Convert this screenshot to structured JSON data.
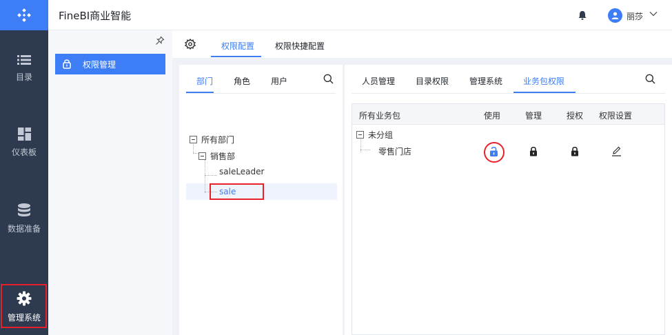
{
  "app": {
    "title": "FineBI商业智能",
    "user": "丽莎"
  },
  "leftnav": {
    "items": [
      {
        "label": "目录"
      },
      {
        "label": "仪表板"
      },
      {
        "label": "数据准备"
      },
      {
        "label": "管理系统"
      }
    ]
  },
  "subnav": {
    "item": "权限管理"
  },
  "main_tabs": [
    "权限配置",
    "权限快捷配置"
  ],
  "org_panel": {
    "tabs": [
      "部门",
      "角色",
      "用户"
    ],
    "tree": {
      "root": "所有部门",
      "dept": "销售部",
      "children": [
        "saleLeader",
        "sale"
      ]
    }
  },
  "perm_panel": {
    "tabs": [
      "人员管理",
      "目录权限",
      "管理系统",
      "业务包权限"
    ],
    "headers": [
      "所有业务包",
      "使用",
      "管理",
      "授权",
      "权限设置"
    ],
    "group": "未分组",
    "package": "零售门店"
  },
  "colors": {
    "accent": "#3d7df5",
    "nav_bg": "#2d3a4f",
    "highlight": "#e8202a"
  },
  "icons": [
    "logo-icon",
    "bell-icon",
    "user-icon",
    "chevron-down-icon",
    "list-icon",
    "dashboard-icon",
    "database-icon",
    "gear-icon",
    "pin-icon",
    "lock-icon",
    "search-icon",
    "unlock-icon",
    "edit-icon"
  ]
}
